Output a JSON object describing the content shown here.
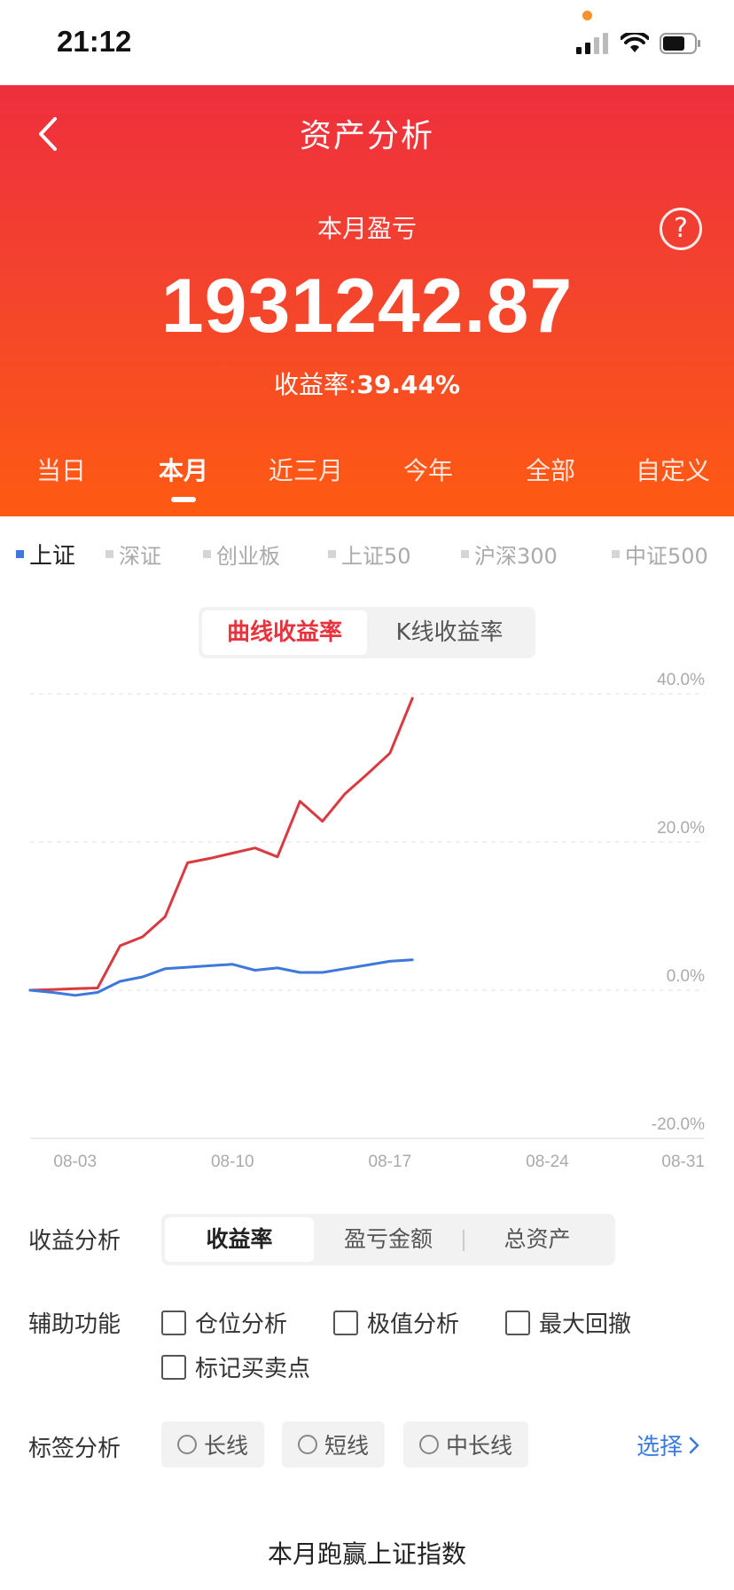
{
  "status": {
    "time": "21:12"
  },
  "header": {
    "title": "资产分析",
    "subtitle": "本月盈亏",
    "amount": "1931242.87",
    "rate_label": "收益率:",
    "rate_value": "39.44%",
    "help": "?"
  },
  "period_tabs": [
    "当日",
    "本月",
    "近三月",
    "今年",
    "全部",
    "自定义"
  ],
  "active_period": "本月",
  "index_tabs": [
    "上证",
    "深证",
    "创业板",
    "上证50",
    "沪深300",
    "中证500"
  ],
  "active_index": "上证",
  "chart_toggle": {
    "curve": "曲线收益率",
    "kline": "K线收益率"
  },
  "chart_data": {
    "type": "line",
    "x_labels": [
      "08-03",
      "08-10",
      "08-17",
      "08-24",
      "08-31"
    ],
    "y_ticks": [
      "40.0%",
      "20.0%",
      "0.0%",
      "-20.0%"
    ],
    "ylim": [
      -20,
      40
    ],
    "series": [
      {
        "color": "#d93a3f",
        "x_days": [
          1,
          2,
          3,
          4,
          5,
          6,
          7,
          8,
          9,
          10,
          11,
          12,
          13,
          14,
          15,
          16,
          17,
          18
        ],
        "values": [
          0.0,
          0.1,
          0.2,
          0.3,
          6.0,
          7.2,
          9.9,
          17.2,
          17.8,
          18.5,
          19.2,
          18.0,
          25.5,
          22.8,
          26.5,
          29.2,
          32.0,
          39.4
        ]
      },
      {
        "color": "#3d78db",
        "x_days": [
          1,
          2,
          3,
          4,
          5,
          6,
          7,
          8,
          9,
          10,
          11,
          12,
          13,
          14,
          15,
          16,
          17,
          18
        ],
        "values": [
          0.0,
          -0.3,
          -0.7,
          -0.3,
          1.2,
          1.8,
          2.9,
          3.1,
          3.3,
          3.5,
          2.7,
          3.0,
          2.4,
          2.4,
          2.9,
          3.4,
          3.9,
          4.1
        ]
      }
    ]
  },
  "analysis": {
    "income_label": "收益分析",
    "income_tabs": [
      "收益率",
      "盈亏金额",
      "总资产"
    ],
    "aux_label": "辅助功能",
    "aux_options": [
      "仓位分析",
      "极值分析",
      "最大回撤",
      "标记买卖点"
    ],
    "tag_label": "标签分析",
    "tags": [
      "长线",
      "短线",
      "中长线"
    ],
    "select": "选择"
  },
  "bottom_title": "本月跑赢上证指数",
  "colors": {
    "accent": "#e8323c",
    "link": "#3b7bdc",
    "index_line": "#3d78db",
    "profit_line": "#d93a3f"
  }
}
